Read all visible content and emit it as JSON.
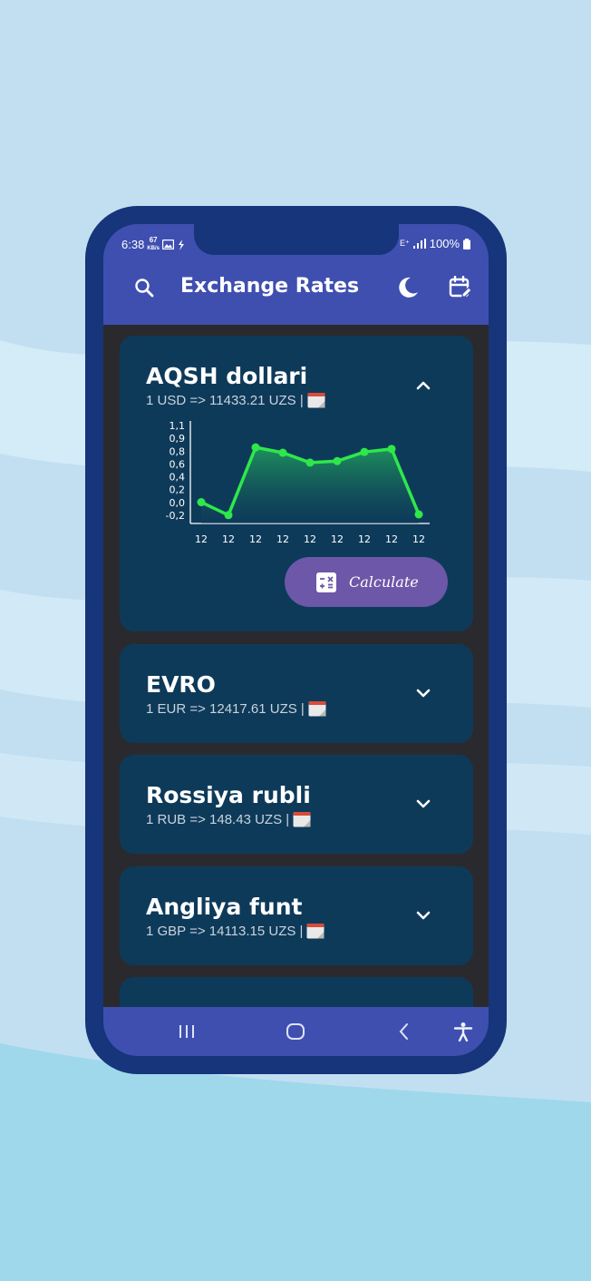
{
  "status": {
    "time": "6:38",
    "speed_top": "67",
    "speed_unit": "KB/s",
    "battery": "100%"
  },
  "appbar": {
    "title": "Exchange Rates"
  },
  "currencies": [
    {
      "name": "AQSH dollari",
      "rate": "1 USD => 11433.21 UZS |",
      "expanded": true
    },
    {
      "name": "EVRO",
      "rate": "1 EUR => 12417.61 UZS |",
      "expanded": false
    },
    {
      "name": "Rossiya rubli",
      "rate": "1 RUB => 148.43 UZS |",
      "expanded": false
    },
    {
      "name": "Angliya funt",
      "rate": "1 GBP => 14113.15 UZS |",
      "expanded": false
    }
  ],
  "calculate_label": "Calculate",
  "chart_data": {
    "type": "area",
    "x": [
      "12",
      "12",
      "12",
      "12",
      "12",
      "12",
      "12",
      "12",
      "12"
    ],
    "y_ticks": [
      "1,1",
      "0,9",
      "0,8",
      "0,6",
      "0,4",
      "0,2",
      "0,0",
      "-0,2"
    ],
    "values": [
      0.08,
      -0.09,
      0.8,
      0.73,
      0.6,
      0.62,
      0.74,
      0.78,
      -0.08
    ],
    "ylim": [
      -0.2,
      1.1
    ],
    "colors": {
      "line": "#2ee84a",
      "fill_top": "#1f9c5c",
      "fill_bottom": "#0e3a5a"
    }
  },
  "colors": {
    "appbar": "#3f4fb0",
    "card": "#0e3a5a",
    "accent_button": "#6c57a8",
    "phone_frame": "#16357a"
  }
}
